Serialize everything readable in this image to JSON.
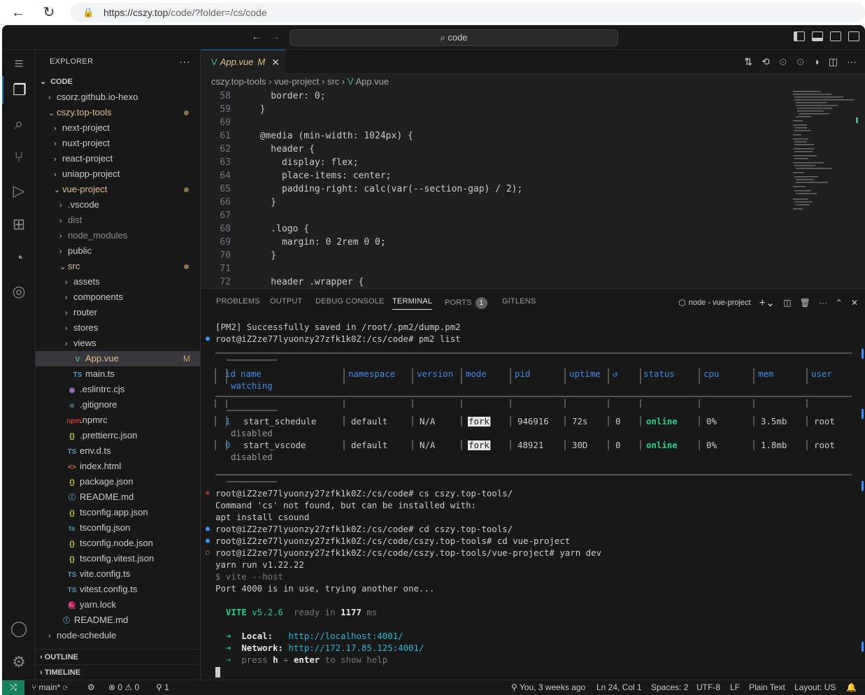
{
  "browser": {
    "url_host": "https://cszy.top",
    "url_path": "/code/?folder=/cs/code"
  },
  "title": {
    "search": "code"
  },
  "explorer": {
    "header": "EXPLORER",
    "more": "···",
    "root": "CODE",
    "items": [
      {
        "label": "csorz.github.io-hexo",
        "indent": 0,
        "chev": "›",
        "icon": ""
      },
      {
        "label": "cszy.top-tools",
        "indent": 0,
        "chev": "⌄",
        "icon": "",
        "dot": true,
        "mod": true
      },
      {
        "label": "next-project",
        "indent": 1,
        "chev": "›",
        "icon": ""
      },
      {
        "label": "nuxt-project",
        "indent": 1,
        "chev": "›",
        "icon": ""
      },
      {
        "label": "react-project",
        "indent": 1,
        "chev": "›",
        "icon": ""
      },
      {
        "label": "uniapp-project",
        "indent": 1,
        "chev": "›",
        "icon": ""
      },
      {
        "label": "vue-project",
        "indent": 1,
        "chev": "⌄",
        "icon": "",
        "dot": true,
        "mod": true
      },
      {
        "label": ".vscode",
        "indent": 2,
        "chev": "›",
        "icon": ""
      },
      {
        "label": "dist",
        "indent": 2,
        "chev": "›",
        "icon": "",
        "dim": true
      },
      {
        "label": "node_modules",
        "indent": 2,
        "chev": "›",
        "icon": "",
        "dim": true
      },
      {
        "label": "public",
        "indent": 2,
        "chev": "›",
        "icon": ""
      },
      {
        "label": "src",
        "indent": 2,
        "chev": "⌄",
        "icon": "",
        "dot": true,
        "mod": true
      },
      {
        "label": "assets",
        "indent": 3,
        "chev": "›",
        "icon": ""
      },
      {
        "label": "components",
        "indent": 3,
        "chev": "›",
        "icon": ""
      },
      {
        "label": "router",
        "indent": 3,
        "chev": "›",
        "icon": ""
      },
      {
        "label": "stores",
        "indent": 3,
        "chev": "›",
        "icon": ""
      },
      {
        "label": "views",
        "indent": 3,
        "chev": "›",
        "icon": ""
      },
      {
        "label": "App.vue",
        "indent": 3,
        "chev": "",
        "icon": "V",
        "iconColor": "#41b883",
        "badge": "M",
        "mod": true,
        "selected": true
      },
      {
        "label": "main.ts",
        "indent": 3,
        "chev": "",
        "icon": "TS",
        "iconColor": "#519aba"
      },
      {
        "label": ".eslintrc.cjs",
        "indent": 2,
        "chev": "",
        "icon": "◉",
        "iconColor": "#a074c4"
      },
      {
        "label": ".gitignore",
        "indent": 2,
        "chev": "",
        "icon": "◆",
        "iconColor": "#41535b"
      },
      {
        "label": ".npmrc",
        "indent": 2,
        "chev": "",
        "icon": "npm",
        "iconColor": "#cb3837"
      },
      {
        "label": ".prettierrc.json",
        "indent": 2,
        "chev": "",
        "icon": "{}",
        "iconColor": "#cbcb41"
      },
      {
        "label": "env.d.ts",
        "indent": 2,
        "chev": "",
        "icon": "TS",
        "iconColor": "#519aba"
      },
      {
        "label": "index.html",
        "indent": 2,
        "chev": "",
        "icon": "<>",
        "iconColor": "#e37933"
      },
      {
        "label": "package.json",
        "indent": 2,
        "chev": "",
        "icon": "{}",
        "iconColor": "#cbcb41"
      },
      {
        "label": "README.md",
        "indent": 2,
        "chev": "",
        "icon": "ⓘ",
        "iconColor": "#519aba"
      },
      {
        "label": "tsconfig.app.json",
        "indent": 2,
        "chev": "",
        "icon": "{}",
        "iconColor": "#cbcb41"
      },
      {
        "label": "tsconfig.json",
        "indent": 2,
        "chev": "",
        "icon": "ts",
        "iconColor": "#519aba"
      },
      {
        "label": "tsconfig.node.json",
        "indent": 2,
        "chev": "",
        "icon": "{}",
        "iconColor": "#cbcb41"
      },
      {
        "label": "tsconfig.vitest.json",
        "indent": 2,
        "chev": "",
        "icon": "{}",
        "iconColor": "#cbcb41"
      },
      {
        "label": "vite.config.ts",
        "indent": 2,
        "chev": "",
        "icon": "TS",
        "iconColor": "#519aba"
      },
      {
        "label": "vitest.config.ts",
        "indent": 2,
        "chev": "",
        "icon": "TS",
        "iconColor": "#519aba"
      },
      {
        "label": "yarn.lock",
        "indent": 2,
        "chev": "",
        "icon": "🧶",
        "iconColor": "#2c8ebb"
      },
      {
        "label": "README.md",
        "indent": 1,
        "chev": "",
        "icon": "ⓘ",
        "iconColor": "#519aba"
      },
      {
        "label": "node-schedule",
        "indent": 0,
        "chev": "›",
        "icon": ""
      }
    ],
    "outline": "OUTLINE",
    "timeline": "TIMELINE"
  },
  "tab": {
    "label": "App.vue",
    "mod": "M"
  },
  "breadcrumb": [
    "cszy.top-tools",
    "vue-project",
    "src",
    "App.vue"
  ],
  "code_lines": [
    {
      "n": "58",
      "t": "    border: 0;"
    },
    {
      "n": "59",
      "t": "  }"
    },
    {
      "n": "60",
      "t": ""
    },
    {
      "n": "61",
      "t": "  @media (min-width: 1024px) {"
    },
    {
      "n": "62",
      "t": "    header {"
    },
    {
      "n": "63",
      "t": "      display: flex;"
    },
    {
      "n": "64",
      "t": "      place-items: center;"
    },
    {
      "n": "65",
      "t": "      padding-right: calc(var(--section-gap) / 2);"
    },
    {
      "n": "66",
      "t": "    }"
    },
    {
      "n": "67",
      "t": ""
    },
    {
      "n": "68",
      "t": "    .logo {"
    },
    {
      "n": "69",
      "t": "      margin: 0 2rem 0 0;"
    },
    {
      "n": "70",
      "t": "    }"
    },
    {
      "n": "71",
      "t": ""
    },
    {
      "n": "72",
      "t": "    header .wrapper {"
    }
  ],
  "panel": {
    "tabs": [
      "PROBLEMS",
      "OUTPUT",
      "DEBUG CONSOLE",
      "TERMINAL",
      "PORTS",
      "GITLENS"
    ],
    "ports_count": "1",
    "terminal_name": "node - vue-project"
  },
  "terminal": {
    "l1": "[PM2] Successfully saved in /root/.pm2/dump.pm2",
    "l2": "root@iZ2ze77lyuonzy27zfk1k0Z:/cs/code# pm2 list",
    "pm2_headers": [
      "id",
      "name",
      "namespace",
      "version",
      "mode",
      "pid",
      "uptime",
      "↺",
      "status",
      "cpu",
      "mem",
      "user",
      "watching"
    ],
    "pm2_rows": [
      [
        "1",
        "start_schedule",
        "default",
        "N/A",
        "fork",
        "946916",
        "72s",
        "0",
        "online",
        "0%",
        "3.5mb",
        "root",
        "disabled"
      ],
      [
        "0",
        "start_vscode",
        "default",
        "N/A",
        "fork",
        "48921",
        "30D",
        "0",
        "online",
        "0%",
        "1.8mb",
        "root",
        "disabled"
      ]
    ],
    "l3": "root@iZ2ze77lyuonzy27zfk1k0Z:/cs/code# cs cszy.top-tools/",
    "l4": "Command 'cs' not found, but can be installed with:",
    "l5": "apt install csound",
    "l6": "root@iZ2ze77lyuonzy27zfk1k0Z:/cs/code# cd cszy.top-tools/",
    "l7": "root@iZ2ze77lyuonzy27zfk1k0Z:/cs/code/cszy.top-tools# cd vue-project",
    "l8": "root@iZ2ze77lyuonzy27zfk1k0Z:/cs/code/cszy.top-tools/vue-project# yarn dev",
    "l9": "yarn run v1.22.22",
    "l10": "$ vite --host",
    "l11": "Port 4000 is in use, trying another one...",
    "vite": "VITE",
    "vite_ver": "v5.2.6",
    "ready": "ready in",
    "ready_ms": "1177",
    "ms": "ms",
    "local_label": "Local:",
    "local_url": "http://localhost:4001/",
    "network_label": "Network:",
    "network_url": "http://172.17.85.125:4001/",
    "press": "press",
    "h": "h",
    "enter": "enter",
    "to_show": "to show help"
  },
  "status": {
    "branch": "main*",
    "errors": "0",
    "warnings": "0",
    "ports": "1",
    "blame": "You, 3 weeks ago",
    "cursor": "Ln 24, Col 1",
    "spaces": "Spaces: 2",
    "encoding": "UTF-8",
    "eol": "LF",
    "lang": "Plain Text",
    "layout": "Layout: US"
  }
}
